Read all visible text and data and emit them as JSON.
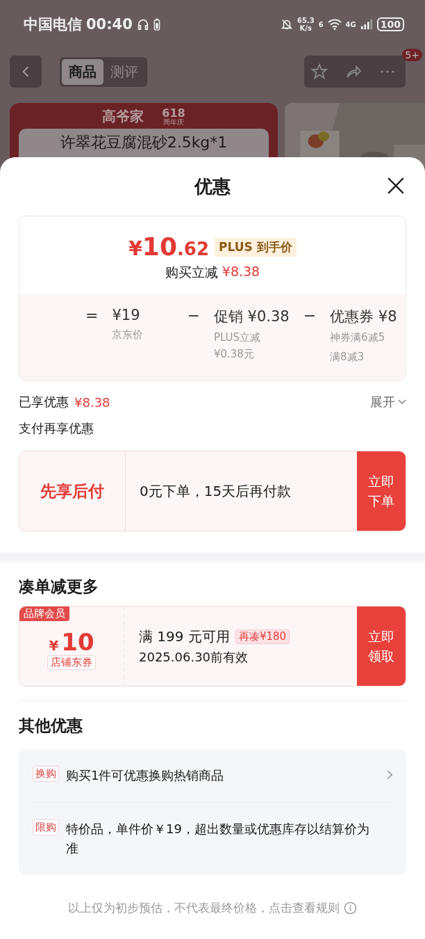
{
  "status_bar": {
    "carrier": "中国电信",
    "time": "00:40",
    "speed_value": "65.3",
    "speed_unit": "K/s",
    "wifi_label": "6",
    "network": "4G",
    "battery": "100"
  },
  "nav": {
    "tabs": [
      {
        "label": "商品",
        "selected": true
      },
      {
        "label": "测评",
        "selected": false
      }
    ],
    "badge": "5+"
  },
  "product": {
    "brand": "高爷家",
    "event": "618",
    "event_sub": "周年庆",
    "title": "许翠花豆腐混砂2.5kg*1"
  },
  "sheet": {
    "title": "优惠"
  },
  "price_card": {
    "symbol": "¥",
    "integer": "10",
    "decimal": ".62",
    "tag": "PLUS 到手价",
    "saving_label": "购买立减",
    "saving_amount": "¥8.38",
    "formula": [
      {
        "op": "=",
        "value": "¥19",
        "notes": [
          "京东价"
        ]
      },
      {
        "op": "−",
        "value": "促销 ¥0.38",
        "notes": [
          "PLUS立减¥0.38元"
        ]
      },
      {
        "op": "−",
        "value": "优惠券 ¥8",
        "notes": [
          "神券满6减5",
          "满8减3"
        ]
      }
    ]
  },
  "enjoyed": {
    "label": "已享优惠",
    "amount": "¥8.38",
    "expand": "展开"
  },
  "pay_section": {
    "label": "支付再享优惠",
    "title": "先享后付",
    "text": "0元下单，15天后再付款",
    "button": "立即下单"
  },
  "more": {
    "heading": "凑单减更多",
    "coupon": {
      "badge": "品牌会员",
      "symbol": "¥",
      "amount": "10",
      "type": "店铺东券",
      "condition": "满 199 元可用",
      "tag": "再凑¥180",
      "validity": "2025.06.30前有效",
      "button": "立即领取"
    }
  },
  "other": {
    "heading": "其他优惠",
    "items": [
      {
        "tag": "换购",
        "text": "购买1件可优惠换购热销商品",
        "has_arrow": true
      },
      {
        "tag": "限购",
        "text": "特价品，单件价￥19，超出数量或优惠库存以结算价为准",
        "has_arrow": false
      }
    ]
  },
  "footer": "以上仅为初步预估，不代表最终价格，点击查看规则"
}
